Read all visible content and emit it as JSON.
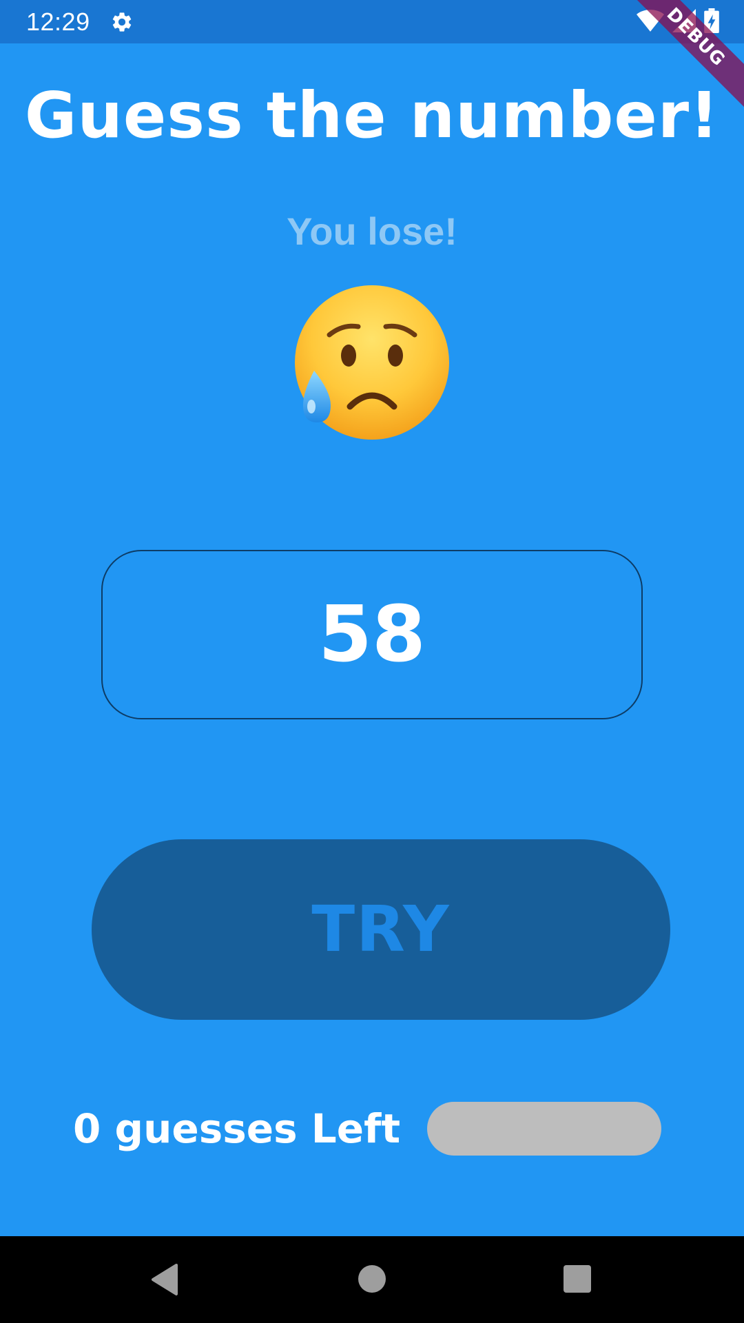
{
  "status_bar": {
    "time": "12:29",
    "icons": [
      "settings-icon",
      "wifi-icon",
      "signal-icon",
      "battery-charging-icon"
    ],
    "debug_label": "DEBUG"
  },
  "game": {
    "title": "Guess the number!",
    "result_message": "You lose!",
    "result_emoji_icon": "sad-but-relieved-face-icon",
    "guess_value": "58",
    "try_label": "TRY",
    "guesses_left_text": "0 guesses Left",
    "guesses_progress_fraction": 0
  },
  "nav_bar": {
    "icons": [
      "back-icon",
      "home-icon",
      "recents-icon"
    ]
  },
  "colors": {
    "background": "#2196F3",
    "status_bar": "#1976D2",
    "button": "#175E99",
    "button_text": "#1E88E5",
    "input_border": "#0D3C66",
    "progress_track": "#BDBDBD"
  }
}
